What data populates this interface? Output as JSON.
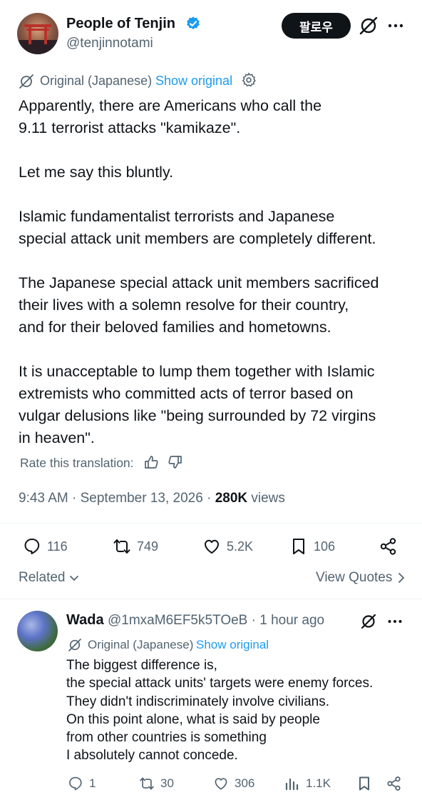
{
  "author": {
    "display_name": "People of Tenjin",
    "handle": "@tenjinnotami",
    "follow_label": "팔로우"
  },
  "translation": {
    "original_label": "Original (Japanese)",
    "show_original": "Show original"
  },
  "post": {
    "paragraphs": [
      "Apparently, there are Americans who call the\n9.11 terrorist attacks \"kamikaze\".",
      "Let me say this bluntly.",
      "Islamic fundamentalist terrorists and Japanese\nspecial attack unit members are completely different.",
      "The Japanese special attack unit members sacrificed\ntheir lives with a solemn resolve for their country,\nand for their beloved families and hometowns.",
      "It is unacceptable to lump them together with Islamic\nextremists who committed acts of terror based on\nvulgar delusions like \"being surrounded by 72 virgins\nin heaven\"."
    ],
    "rate_translation": "Rate this translation:",
    "time": "9:43 AM",
    "date": "September 13, 2026",
    "views_count": "280K",
    "views_label": "views",
    "separator": "·"
  },
  "actions": {
    "replies": "116",
    "reposts": "749",
    "likes": "5.2K",
    "bookmarks": "106"
  },
  "related": {
    "label": "Related",
    "view_quotes": "View Quotes"
  },
  "reply": {
    "name": "Wada",
    "handle_time": "@1mxaM6EF5k5TOeB · 1 hour ago",
    "original_label": "Original (Japanese)",
    "show_original": "Show original",
    "lines": [
      "The biggest difference is,",
      "the special attack units' targets were enemy forces.",
      "They didn't indiscriminately involve civilians.",
      "On this point alone, what is said by people",
      "from other countries is something",
      "I absolutely cannot concede."
    ],
    "actions": {
      "replies": "1",
      "reposts": "30",
      "likes": "306",
      "views": "1.1K"
    }
  },
  "colors": {
    "text": "#0f1419",
    "secondary": "#536471",
    "link": "#1d9bf0",
    "verified": "#1d9bf0",
    "follow_bg": "#0f1419"
  },
  "icons": [
    "verified-badge-icon",
    "grok-icon",
    "more-icon",
    "translate-icon",
    "gear-icon",
    "thumbs-up-icon",
    "thumbs-down-icon",
    "reply-icon",
    "repost-icon",
    "like-icon",
    "bookmark-icon",
    "share-icon",
    "chevron-down-icon",
    "chevron-right-icon",
    "views-icon"
  ]
}
